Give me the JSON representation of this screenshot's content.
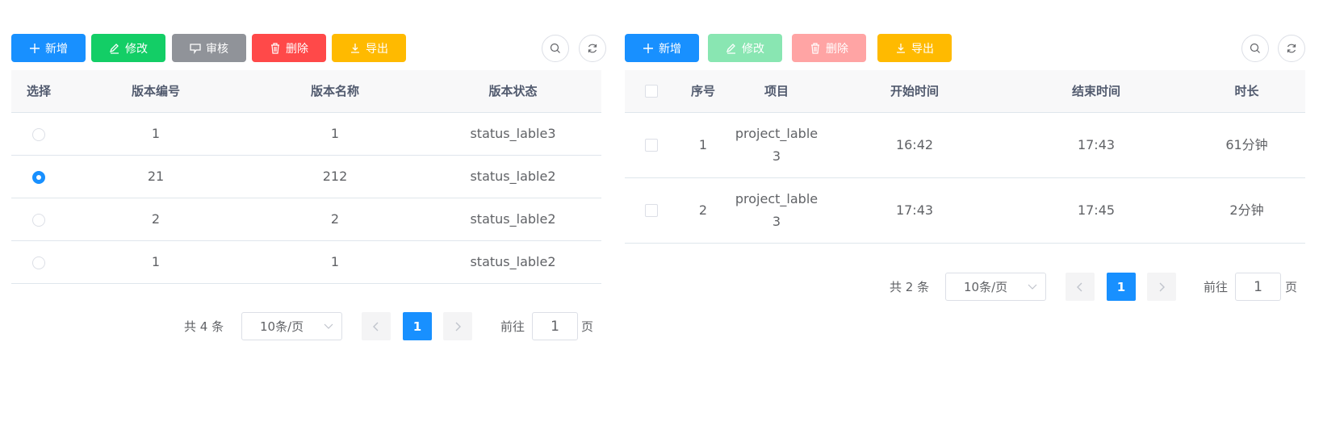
{
  "left": {
    "toolbar": {
      "add_label": "新增",
      "edit_label": "修改",
      "audit_label": "审核",
      "delete_label": "删除",
      "export_label": "导出"
    },
    "table": {
      "headers": [
        "选择",
        "版本编号",
        "版本名称",
        "版本状态"
      ],
      "rows": [
        {
          "selected": false,
          "number": "1",
          "name": "1",
          "status": "status_lable3"
        },
        {
          "selected": true,
          "number": "21",
          "name": "212",
          "status": "status_lable2"
        },
        {
          "selected": false,
          "number": "2",
          "name": "2",
          "status": "status_lable2"
        },
        {
          "selected": false,
          "number": "1",
          "name": "1",
          "status": "status_lable2"
        }
      ]
    },
    "pager": {
      "total": "共 4 条",
      "page_size": "10条/页",
      "current_page": "1",
      "goto_label": "前往",
      "goto_value": "1",
      "goto_suffix": "页"
    }
  },
  "right": {
    "toolbar": {
      "add_label": "新增",
      "edit_label": "修改",
      "delete_label": "删除",
      "export_label": "导出"
    },
    "table": {
      "headers": [
        "",
        "序号",
        "项目",
        "开始时间",
        "结束时间",
        "时长"
      ],
      "rows": [
        {
          "index": "1",
          "project_line1": "project_lable",
          "project_line2": "3",
          "start": "16:42",
          "end": "17:43",
          "duration": "61分钟"
        },
        {
          "index": "2",
          "project_line1": "project_lable",
          "project_line2": "3",
          "start": "17:43",
          "end": "17:45",
          "duration": "2分钟"
        }
      ]
    },
    "pager": {
      "total": "共 2 条",
      "page_size": "10条/页",
      "current_page": "1",
      "goto_label": "前往",
      "goto_value": "1",
      "goto_suffix": "页"
    }
  },
  "colors": {
    "primary": "#1890ff",
    "success": "#13ce66",
    "info": "#909399",
    "danger": "#ff4949",
    "warning": "#ffba00"
  },
  "icons": {
    "add": "plus-icon",
    "edit": "pencil-icon",
    "audit": "stamp-icon",
    "delete": "trash-icon",
    "export": "download-icon",
    "search": "search-icon",
    "refresh": "refresh-icon"
  }
}
